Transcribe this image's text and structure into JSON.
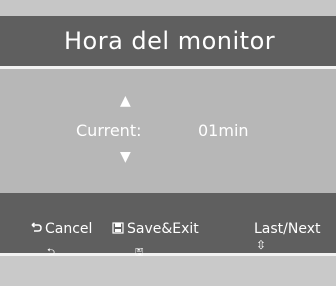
{
  "title": "Hora del monitor",
  "setting": {
    "label": "Current:",
    "value": "01min"
  },
  "buttons": {
    "cancel": "Cancel",
    "save_exit": "Save&Exit",
    "last_next": "Last/Next"
  },
  "icons": {
    "up": "▲",
    "down": "▼",
    "cancel_small": "⮌",
    "save_small": "🖫",
    "ln_small": "⇳"
  }
}
